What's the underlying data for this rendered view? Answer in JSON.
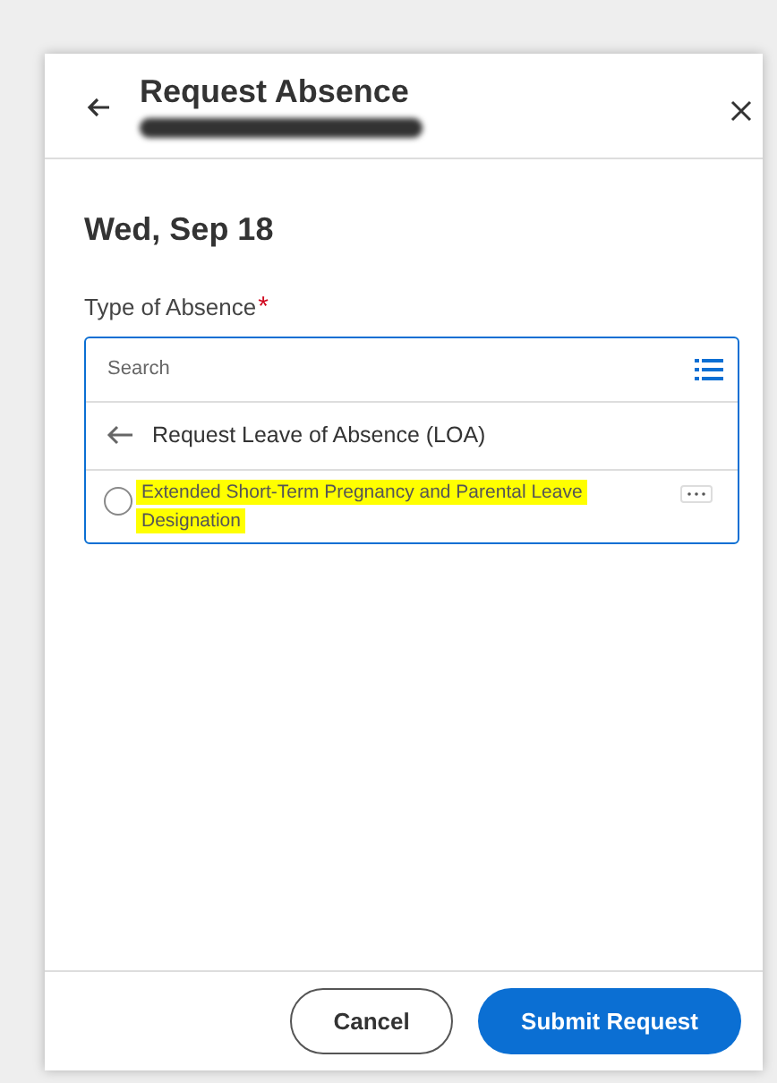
{
  "dialog": {
    "title": "Request Absence",
    "date_heading": "Wed, Sep 18"
  },
  "field": {
    "label": "Type of Absence",
    "required_mark": "*",
    "placeholder": "Search",
    "breadcrumb": "Request Leave of Absence (LOA)",
    "options": [
      {
        "label": "Extended Short-Term Pregnancy and Parental Leave Designation",
        "selected": false,
        "highlighted": true
      }
    ]
  },
  "buttons": [
    {
      "label": "Cancel",
      "kind": "secondary"
    },
    {
      "label": "Submit Request",
      "kind": "primary"
    }
  ]
}
